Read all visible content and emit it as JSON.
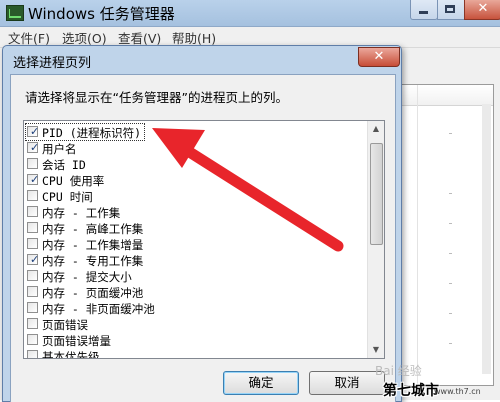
{
  "window": {
    "title": "Windows 任务管理器",
    "close_glyph": "✕",
    "menu": [
      "文件(F)",
      "选项(O)",
      "查看(V)",
      "帮助(H)"
    ]
  },
  "dialog": {
    "title": "选择进程页列",
    "close_glyph": "✕",
    "instruction": "请选择将显示在“任务管理器”的进程页上的列。",
    "columns": [
      {
        "label": "PID (进程标识符)",
        "checked": true
      },
      {
        "label": "用户名",
        "checked": true
      },
      {
        "label": "会话 ID",
        "checked": false
      },
      {
        "label": "CPU 使用率",
        "checked": true
      },
      {
        "label": "CPU 时间",
        "checked": false
      },
      {
        "label": "内存 - 工作集",
        "checked": false
      },
      {
        "label": "内存 - 高峰工作集",
        "checked": false
      },
      {
        "label": "内存 - 工作集增量",
        "checked": false
      },
      {
        "label": "内存 - 专用工作集",
        "checked": true
      },
      {
        "label": "内存 - 提交大小",
        "checked": false
      },
      {
        "label": "内存 - 页面缓冲池",
        "checked": false
      },
      {
        "label": "内存 - 非页面缓冲池",
        "checked": false
      },
      {
        "label": "页面错误",
        "checked": false
      },
      {
        "label": "页面错误增量",
        "checked": false
      },
      {
        "label": "基本优先级",
        "checked": false
      }
    ],
    "ok_label": "确定",
    "cancel_label": "取消"
  },
  "overlay": {
    "watermark": "Bai 经验",
    "site_logo": "第七城市",
    "site_url": "www.th7.cn",
    "arrow_color": "#e8252b"
  }
}
